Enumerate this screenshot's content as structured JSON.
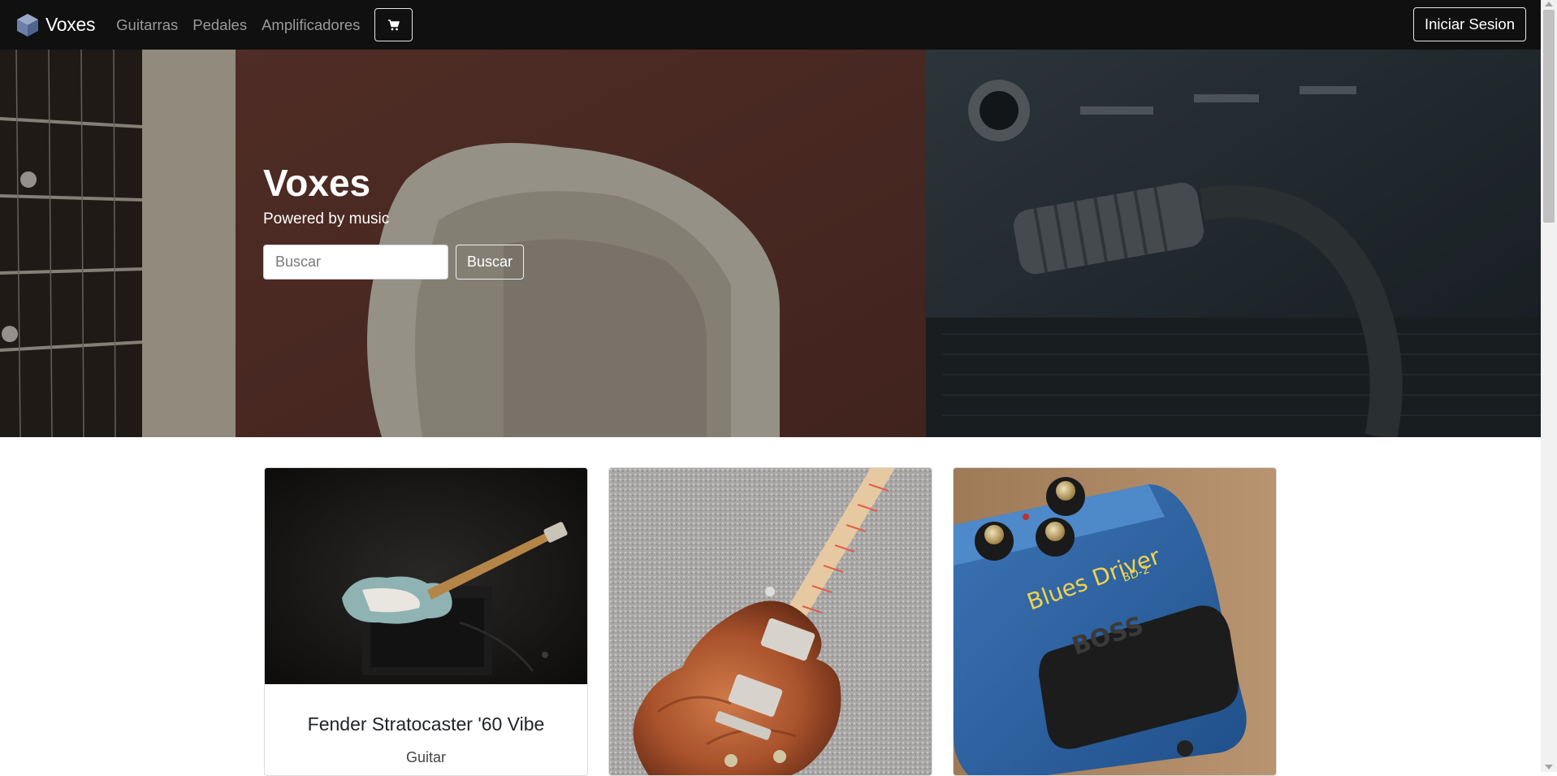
{
  "navbar": {
    "brand": "Voxes",
    "brand_icon": "cube-icon",
    "links": [
      "Guitarras",
      "Pedales",
      "Amplificadores"
    ],
    "cart_icon": "cart-icon",
    "login_label": "Iniciar Sesion"
  },
  "hero": {
    "title": "Voxes",
    "subtitle": "Powered by music",
    "search_placeholder": "Buscar",
    "search_button": "Buscar"
  },
  "products": [
    {
      "title": "Fender Stratocaster '60 Vibe",
      "category": "Guitar"
    },
    {
      "title": "",
      "category": ""
    },
    {
      "title": "",
      "category": ""
    }
  ],
  "colors": {
    "navbar_bg": "#101010",
    "nav_link": "#9a9a9a",
    "accent_white": "#ffffff"
  }
}
